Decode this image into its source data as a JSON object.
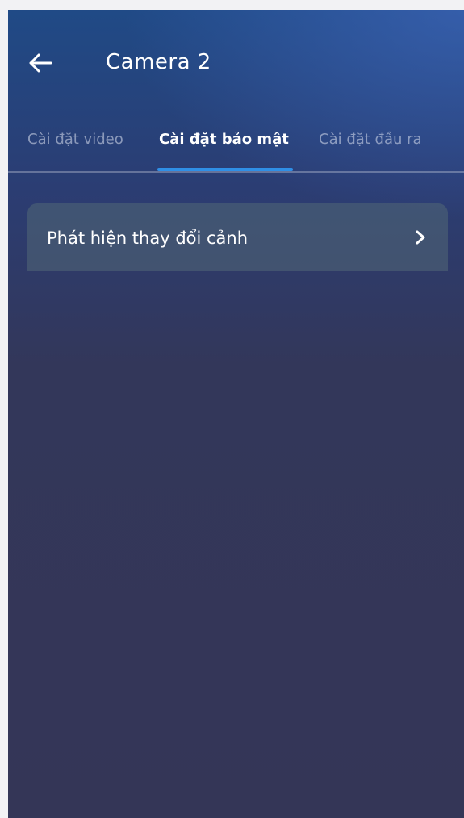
{
  "app_bar": {
    "title": "Camera 2",
    "back_icon": "arrow-left-icon"
  },
  "tabs": [
    {
      "label": "Cài đặt video",
      "active": false
    },
    {
      "label": "Cài đặt bảo mật",
      "active": true
    },
    {
      "label": "Cài đặt đầu ra",
      "active": false
    }
  ],
  "settings_list": [
    {
      "label": "Phát hiện thay đổi cảnh",
      "icon": "chevron-right-icon"
    }
  ],
  "colors": {
    "accent": "#2f8fe6",
    "background_top": "#204a86",
    "background_bottom": "#343657",
    "row_background": "#526876"
  }
}
